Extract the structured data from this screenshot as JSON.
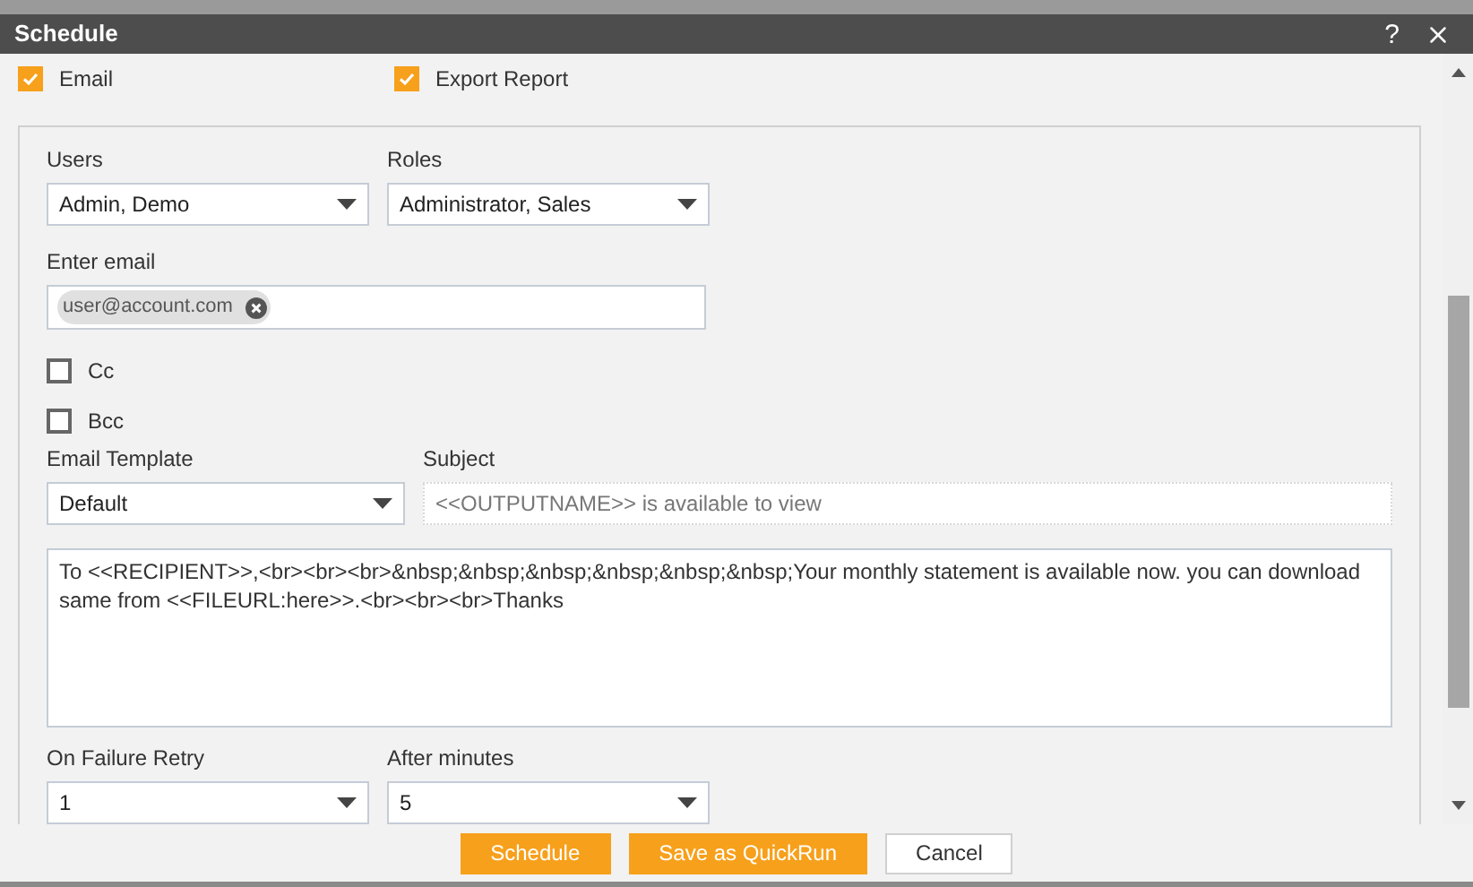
{
  "window": {
    "title": "Schedule",
    "help": "?"
  },
  "options": [
    {
      "label": "Email",
      "checked": true
    },
    {
      "label": "Export Report",
      "checked": true
    }
  ],
  "recipients": [
    {
      "label": "Users",
      "value": "Admin, Demo"
    },
    {
      "label": "Roles",
      "value": "Administrator, Sales"
    }
  ],
  "email": {
    "label": "Enter email",
    "chips": [
      "user@account.com"
    ]
  },
  "copies": [
    {
      "label": "Cc",
      "checked": false
    },
    {
      "label": "Bcc",
      "checked": false
    }
  ],
  "template": {
    "label": "Email Template",
    "value": "Default"
  },
  "subject": {
    "label": "Subject",
    "placeholder": "<<OUTPUTNAME>> is available to view"
  },
  "body": "To <<RECIPIENT>>,<br><br><br>&nbsp;&nbsp;&nbsp;&nbsp;&nbsp;&nbsp;Your monthly statement is available now. you can download same from <<FILEURL:here>>.<br><br><br>Thanks",
  "retry": [
    {
      "label": "On Failure Retry",
      "value": "1"
    },
    {
      "label": "After minutes",
      "value": "5"
    }
  ],
  "buttons": [
    {
      "label": "Schedule",
      "kind": "primary"
    },
    {
      "label": "Save as QuickRun",
      "kind": "primary"
    },
    {
      "label": "Cancel",
      "kind": "secondary"
    }
  ]
}
